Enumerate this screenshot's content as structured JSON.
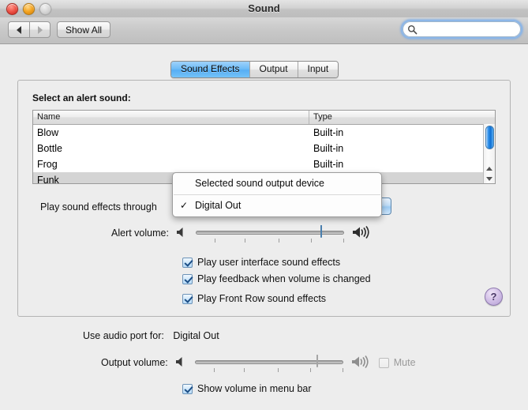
{
  "window": {
    "title": "Sound",
    "controls": {
      "close": "close",
      "minimize": "minimize",
      "zoom": "zoom"
    }
  },
  "toolbar": {
    "back_label": "◀",
    "forward_label": "▶",
    "show_all_label": "Show All",
    "search": {
      "value": "",
      "placeholder": "",
      "icon": "search-icon"
    }
  },
  "tabs": [
    {
      "label": "Sound Effects",
      "selected": true
    },
    {
      "label": "Output",
      "selected": false
    },
    {
      "label": "Input",
      "selected": false
    }
  ],
  "main": {
    "section_label": "Select an alert sound:",
    "table": {
      "columns": [
        "Name",
        "Type"
      ],
      "rows": [
        {
          "name": "Blow",
          "type": "Built-in",
          "selected": false
        },
        {
          "name": "Bottle",
          "type": "Built-in",
          "selected": false
        },
        {
          "name": "Frog",
          "type": "Built-in",
          "selected": false
        },
        {
          "name": "Funk",
          "type": "",
          "selected": true
        }
      ]
    },
    "output_device": {
      "label": "Play sound effects through",
      "value": "Digital Out"
    },
    "open_menu": {
      "header": "Selected sound output device",
      "checkmark": "✓",
      "items": [
        {
          "label": "Digital Out",
          "checked": true
        }
      ]
    },
    "alert_volume": {
      "label": "Alert volume:",
      "value_percent": 88,
      "min_icon": "speaker-mute-icon",
      "max_icon": "speaker-loud-icon"
    },
    "checkboxes": [
      {
        "label": "Play user interface sound effects",
        "checked": true
      },
      {
        "label": "Play feedback when volume is changed",
        "checked": true
      },
      {
        "label": "Play Front Row sound effects",
        "checked": true
      }
    ],
    "help_label": "?"
  },
  "bottom": {
    "audio_port_label": "Use audio port for:",
    "audio_port_value": "Digital Out",
    "output_volume": {
      "label": "Output volume:",
      "value_percent": 86,
      "disabled": true,
      "mute_label": "Mute",
      "mute_checked": false
    },
    "show_volume_menu_bar": {
      "label": "Show volume in menu bar",
      "checked": true
    }
  },
  "colors": {
    "accent_blue": "#57aef4",
    "window_bg": "#ededed",
    "selection_gray": "#d4d4d4",
    "help_purple": "#b49fd4"
  }
}
